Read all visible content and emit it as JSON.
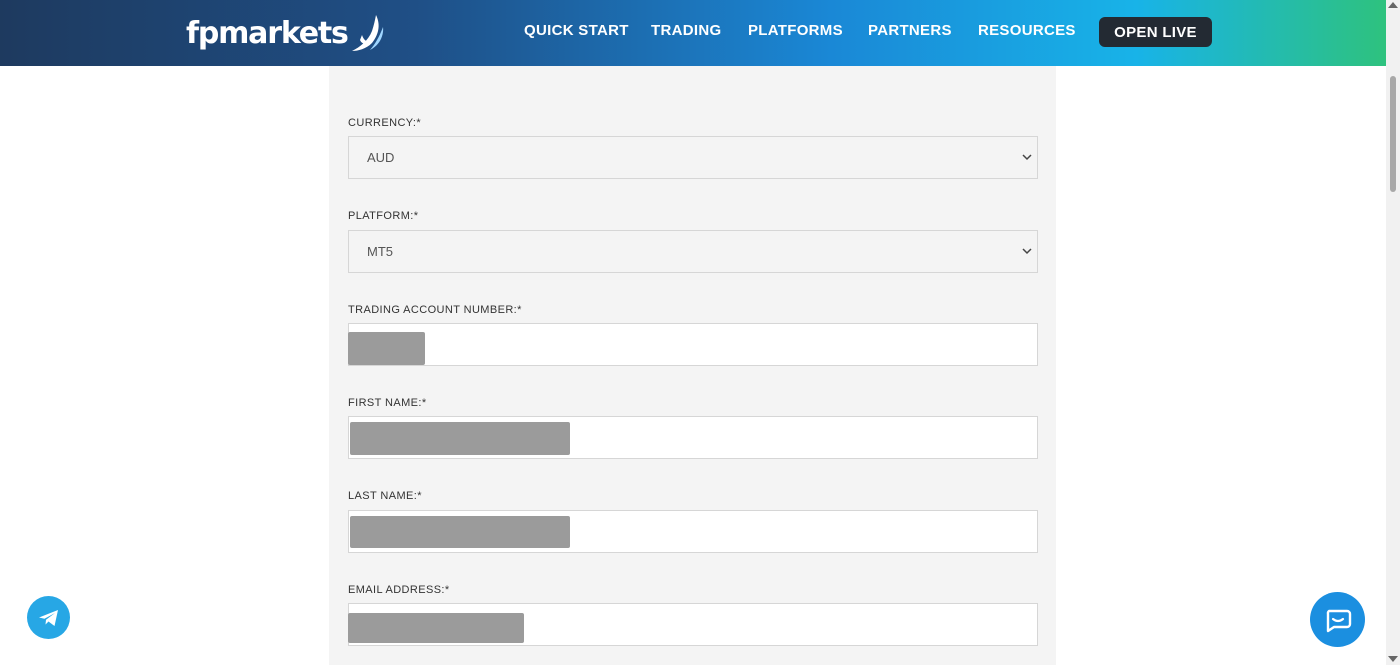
{
  "header": {
    "logo_text": "fpmarkets",
    "nav": [
      "QUICK START",
      "TRADING",
      "PLATFORMS",
      "PARTNERS",
      "RESOURCES"
    ],
    "cta_label": "OPEN LIVE"
  },
  "form": {
    "currency": {
      "label": "CURRENCY:*",
      "value": "AUD"
    },
    "platform": {
      "label": "PLATFORM:*",
      "value": "MT5"
    },
    "account_number": {
      "label": "TRADING ACCOUNT NUMBER:*"
    },
    "first_name": {
      "label": "FIRST NAME:*"
    },
    "last_name": {
      "label": "LAST NAME:*"
    },
    "email": {
      "label": "EMAIL ADDRESS:*"
    }
  },
  "icons": {
    "telegram": "telegram-icon",
    "chat": "chat-icon",
    "select_arrow": "chevron-down-icon"
  },
  "colors": {
    "header_gradient_start": "#1e3a5f",
    "header_gradient_end": "#2ec27e",
    "cta_background": "#232a33",
    "form_background": "#f4f4f4",
    "redaction": "#9b9b9b",
    "telegram_blue": "#27a7e5",
    "chat_blue": "#1b8fe0"
  }
}
